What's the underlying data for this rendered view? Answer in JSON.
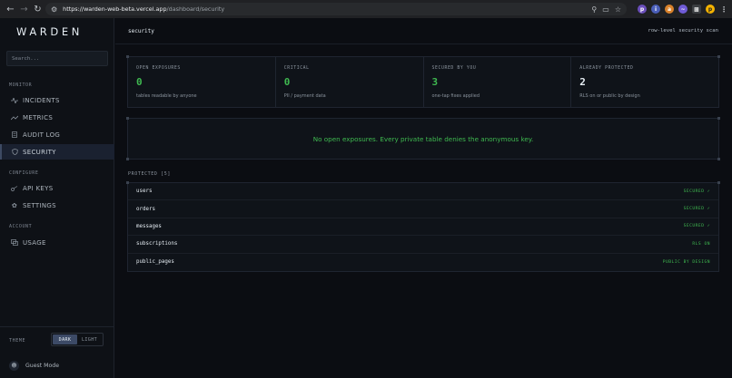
{
  "browser": {
    "url_domain": "https://warden-web-beta.vercel.app",
    "url_path": "/dashboard/security"
  },
  "sidebar": {
    "logo": "WARDEN",
    "search_placeholder": "Search...",
    "sections": [
      {
        "label": "MONITOR",
        "items": [
          {
            "label": "INCIDENTS",
            "icon": "pulse-icon",
            "active": false
          },
          {
            "label": "METRICS",
            "icon": "chart-icon",
            "active": false
          },
          {
            "label": "AUDIT LOG",
            "icon": "log-icon",
            "active": false
          },
          {
            "label": "SECURITY",
            "icon": "shield-icon",
            "active": true
          }
        ]
      },
      {
        "label": "CONFIGURE",
        "items": [
          {
            "label": "API KEYS",
            "icon": "key-icon",
            "active": false
          },
          {
            "label": "SETTINGS",
            "icon": "gear-icon",
            "active": false
          }
        ]
      },
      {
        "label": "ACCOUNT",
        "items": [
          {
            "label": "USAGE",
            "icon": "usage-icon",
            "active": false
          }
        ]
      }
    ],
    "theme_label": "THEME",
    "theme_dark": "DARK",
    "theme_light": "LIGHT",
    "theme_selected": "DARK",
    "guest_label": "Guest Mode"
  },
  "header": {
    "title": "security",
    "subtitle": "row-level security scan"
  },
  "stats": [
    {
      "label": "OPEN EXPOSURES",
      "value": "0",
      "desc": "tables readable by anyone",
      "color": "#3fb950"
    },
    {
      "label": "CRITICAL",
      "value": "0",
      "desc": "PII / payment data",
      "color": "#3fb950"
    },
    {
      "label": "SECURED BY YOU",
      "value": "3",
      "desc": "one-tap fixes applied",
      "color": "#3fb950"
    },
    {
      "label": "ALREADY PROTECTED",
      "value": "2",
      "desc": "RLS on or public by design",
      "color": "#e6edf3"
    }
  ],
  "banner": {
    "text": "No open exposures. Every private table denies the anonymous key.",
    "color": "#3fb950"
  },
  "protected": {
    "label": "PROTECTED [5]",
    "rows": [
      {
        "name": "users",
        "status": "SECURED ✓"
      },
      {
        "name": "orders",
        "status": "SECURED ✓"
      },
      {
        "name": "messages",
        "status": "SECURED ✓"
      },
      {
        "name": "subscriptions",
        "status": "RLS ON"
      },
      {
        "name": "public_pages",
        "status": "PUBLIC BY DESIGN"
      }
    ],
    "status_color": "#3fb950"
  }
}
